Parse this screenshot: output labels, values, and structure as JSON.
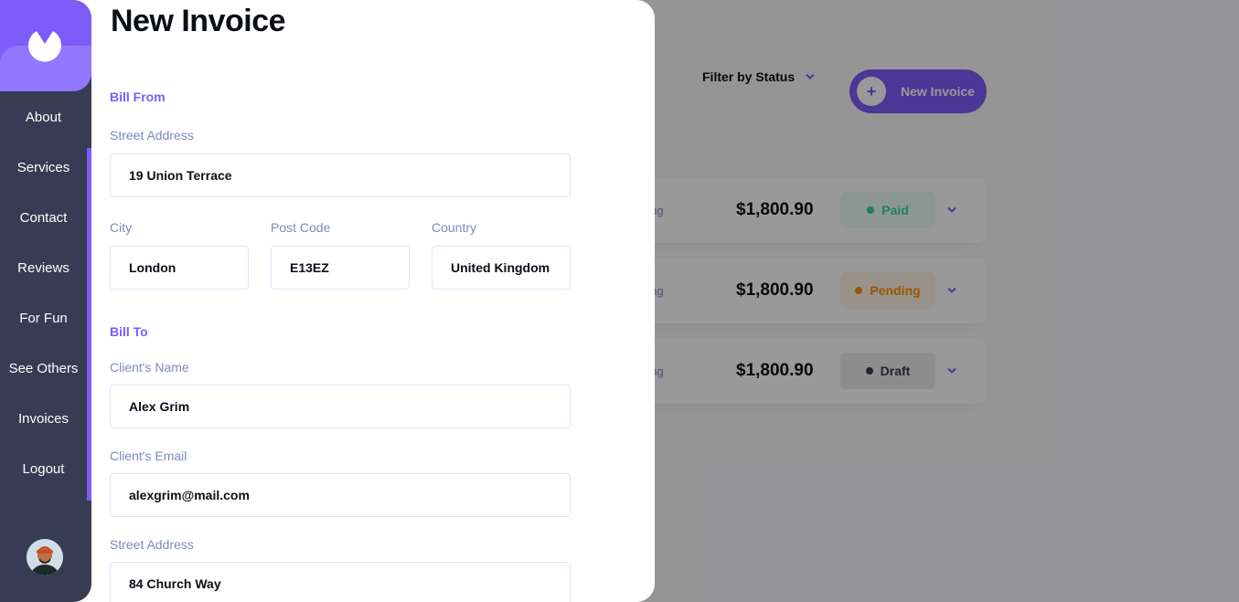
{
  "app": {
    "colors": {
      "accent": "#7c5dfa",
      "accent_light": "#9277ff",
      "sidebar": "#373b53",
      "paid": "#33d69f",
      "pending": "#ff8f00",
      "draft": "#373b53"
    }
  },
  "sidebar": {
    "logo_icon": "half-circle-logo-icon",
    "items": [
      {
        "label": "About"
      },
      {
        "label": "Services"
      },
      {
        "label": "Contact"
      },
      {
        "label": "Reviews"
      },
      {
        "label": "For Fun"
      },
      {
        "label": "See Others"
      },
      {
        "label": "Invoices"
      },
      {
        "label": "Logout"
      }
    ],
    "avatar_icon": "user-avatar"
  },
  "background": {
    "filter_label": "Filter by Status",
    "new_invoice_label": "New Invoice",
    "invoices": [
      {
        "client": "ang",
        "amount": "$1,800.90",
        "status": "Paid",
        "status_key": "paid"
      },
      {
        "client": "ang",
        "amount": "$1,800.90",
        "status": "Pending",
        "status_key": "pending"
      },
      {
        "client": "ang",
        "amount": "$1,800.90",
        "status": "Draft",
        "status_key": "draft"
      }
    ]
  },
  "form": {
    "title": "New Invoice",
    "bill_from": {
      "heading": "Bill From",
      "street_label": "Street Address",
      "street_value": "19 Union Terrace",
      "city_label": "City",
      "city_value": "London",
      "postcode_label": "Post Code",
      "postcode_value": "E13EZ",
      "country_label": "Country",
      "country_value": "United Kingdom"
    },
    "bill_to": {
      "heading": "Bill To",
      "name_label": "Client's Name",
      "name_value": "Alex Grim",
      "email_label": "Client's Email",
      "email_value": "alexgrim@mail.com",
      "street_label": "Street Address",
      "street_value": "84 Church Way"
    }
  }
}
